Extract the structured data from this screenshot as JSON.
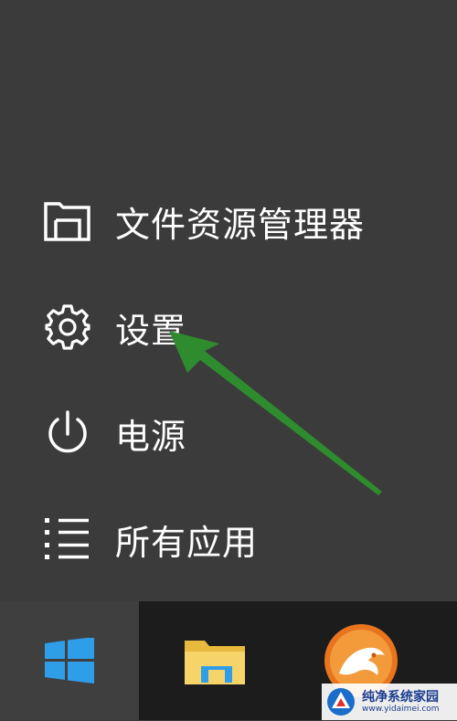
{
  "start_menu": {
    "items": [
      {
        "label": "文件资源管理器",
        "icon": "file-explorer-icon"
      },
      {
        "label": "设置",
        "icon": "gear-icon"
      },
      {
        "label": "电源",
        "icon": "power-icon"
      },
      {
        "label": "所有应用",
        "icon": "list-icon"
      }
    ]
  },
  "taskbar": {
    "items": [
      {
        "icon": "windows-logo-icon"
      },
      {
        "icon": "folder-icon"
      },
      {
        "icon": "browser-icon"
      }
    ]
  },
  "annotation": {
    "arrow_color": "#2e8b2e",
    "target": "设置"
  },
  "watermark": {
    "title": "纯净系统家园",
    "url": "www.yidaimei.com"
  },
  "colors": {
    "menu_bg": "#3b3b3b",
    "taskbar_bg": "#1c1c1c",
    "start_button_bg": "#3f3f3f",
    "windows_blue": "#2f9ee8",
    "text": "#ffffff"
  }
}
